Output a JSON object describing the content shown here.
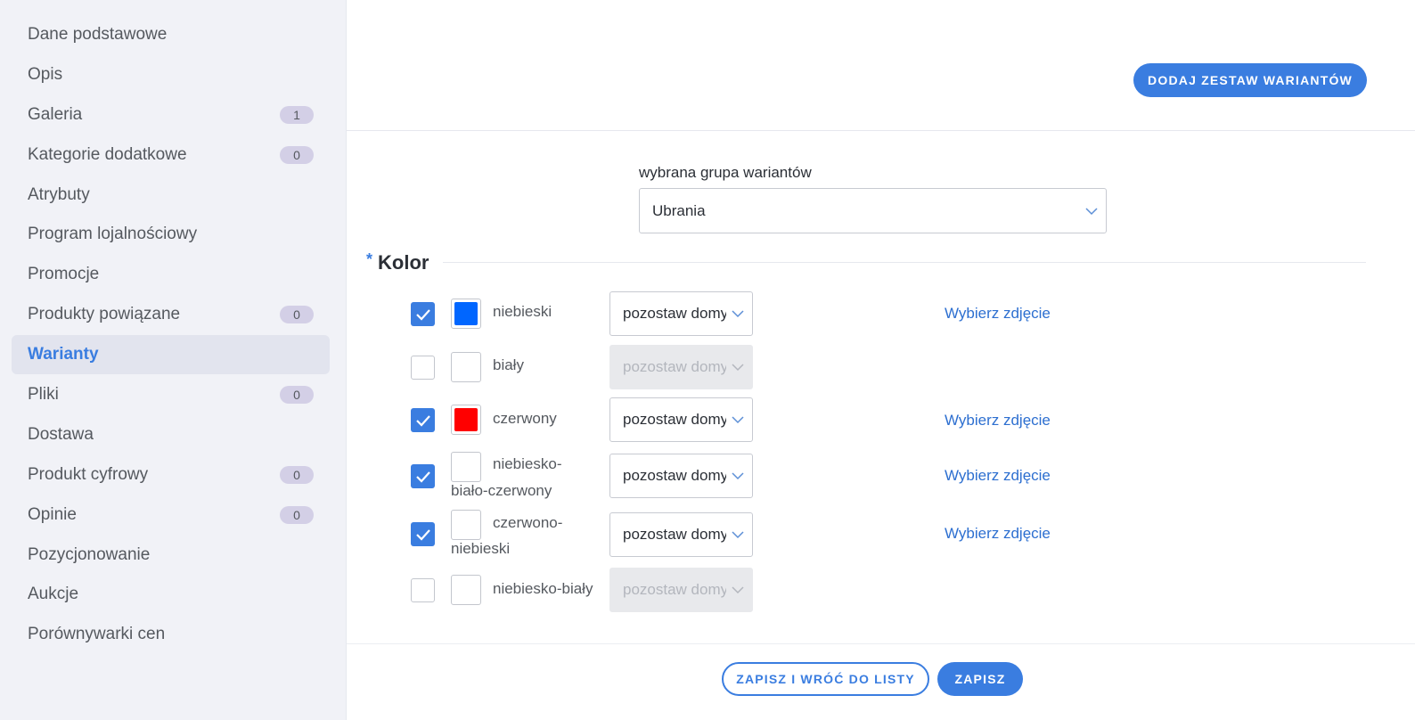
{
  "sidebar": {
    "items": [
      {
        "label": "Dane podstawowe",
        "badge": null
      },
      {
        "label": "Opis",
        "badge": null
      },
      {
        "label": "Galeria",
        "badge": "1"
      },
      {
        "label": "Kategorie dodatkowe",
        "badge": "0"
      },
      {
        "label": "Atrybuty",
        "badge": null
      },
      {
        "label": "Program lojalnościowy",
        "badge": null
      },
      {
        "label": "Promocje",
        "badge": null
      },
      {
        "label": "Produkty powiązane",
        "badge": "0"
      },
      {
        "label": "Warianty",
        "badge": null,
        "active": true
      },
      {
        "label": "Pliki",
        "badge": "0"
      },
      {
        "label": "Dostawa",
        "badge": null
      },
      {
        "label": "Produkt cyfrowy",
        "badge": "0"
      },
      {
        "label": "Opinie",
        "badge": "0"
      },
      {
        "label": "Pozycjonowanie",
        "badge": null
      },
      {
        "label": "Aukcje",
        "badge": null
      },
      {
        "label": "Porównywarki cen",
        "badge": null
      }
    ]
  },
  "header": {
    "add_variant_set_label": "DODAJ ZESTAW WARIANTÓW"
  },
  "variant_group": {
    "label": "wybrana grupa wariantów",
    "selected": "Ubrania"
  },
  "section": {
    "required_mark": "*",
    "title": "Kolor"
  },
  "colors": [
    {
      "name_line1": "niebieski",
      "name_line2": "",
      "checked": true,
      "swatch": "#0066ff",
      "select": "pozostaw domyślne",
      "link": "Wybierz zdjęcie"
    },
    {
      "name_line1": "biały",
      "name_line2": "",
      "checked": false,
      "swatch": "",
      "select": "pozostaw domyślne",
      "link": ""
    },
    {
      "name_line1": "czerwony",
      "name_line2": "",
      "checked": true,
      "swatch": "#ff0000",
      "select": "pozostaw domyślne",
      "link": "Wybierz zdjęcie"
    },
    {
      "name_line1": "niebiesko-",
      "name_line2": "biało-czerwony",
      "checked": true,
      "swatch": "",
      "select": "pozostaw domyślne",
      "link": "Wybierz zdjęcie"
    },
    {
      "name_line1": "czerwono-",
      "name_line2": "niebieski",
      "checked": true,
      "swatch": "",
      "select": "pozostaw domyślne",
      "link": "Wybierz zdjęcie"
    },
    {
      "name_line1": "niebiesko-biały",
      "name_line2": "",
      "checked": false,
      "swatch": "",
      "select": "pozostaw domyślne",
      "link": ""
    }
  ],
  "footer": {
    "save_and_return_label": "ZAPISZ I WRÓĆ DO LISTY",
    "save_label": "ZAPISZ"
  },
  "colors_theme": {
    "accent": "#3a7de0",
    "sidebar_bg": "#f1f2f7",
    "badge_bg": "#d3cfe6"
  }
}
